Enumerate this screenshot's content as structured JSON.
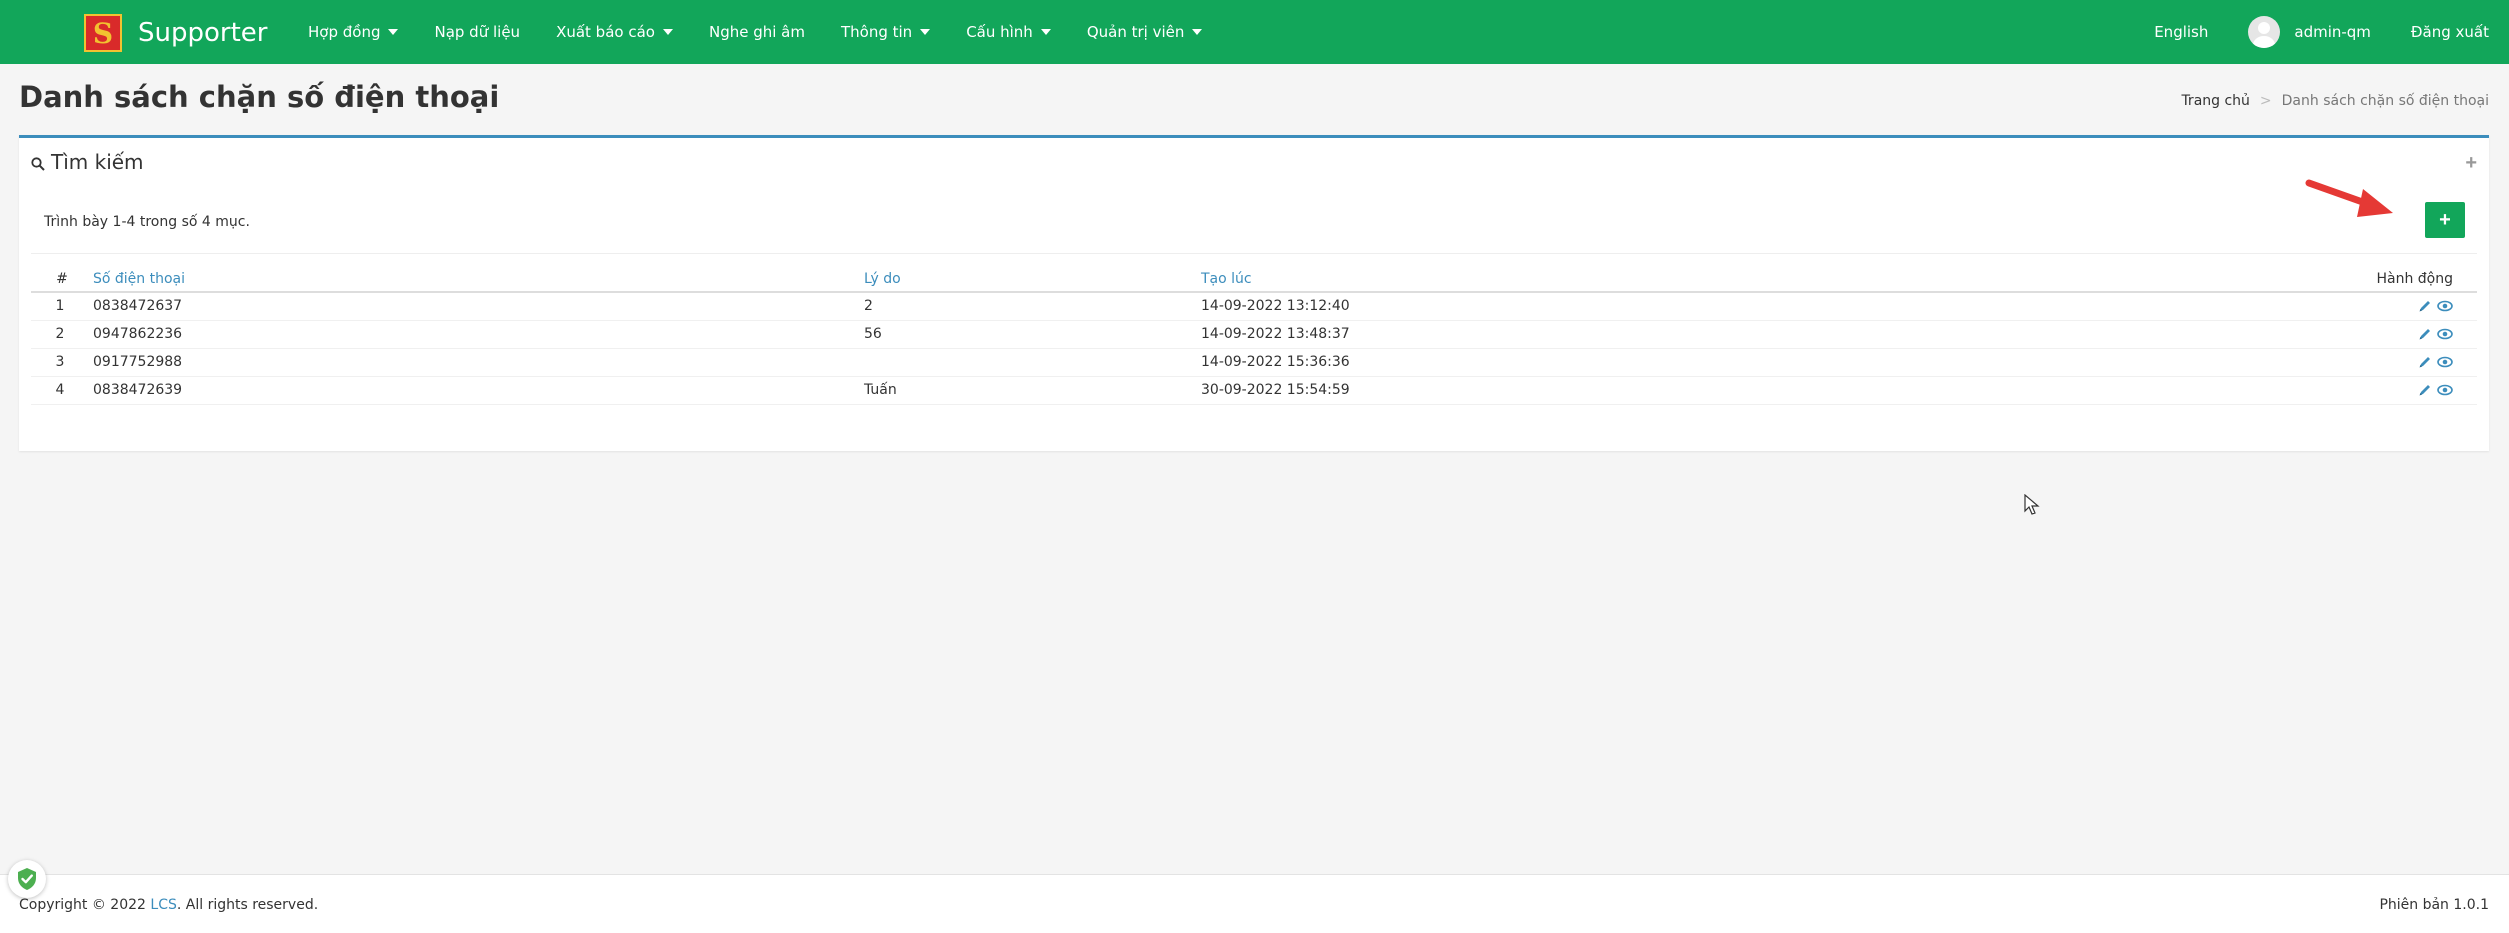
{
  "brand": {
    "logo_letter": "S",
    "name": "Supporter"
  },
  "nav": {
    "items": [
      {
        "label": "Hợp đồng",
        "dropdown": true
      },
      {
        "label": "Nạp dữ liệu",
        "dropdown": false
      },
      {
        "label": "Xuất báo cáo",
        "dropdown": true
      },
      {
        "label": "Nghe ghi âm",
        "dropdown": false
      },
      {
        "label": "Thông tin",
        "dropdown": true
      },
      {
        "label": "Cấu hình",
        "dropdown": true
      },
      {
        "label": "Quản trị viên",
        "dropdown": true
      }
    ],
    "language": "English",
    "user": "admin-qm",
    "logout": "Đăng xuất"
  },
  "page": {
    "title": "Danh sách chặn số điện thoại"
  },
  "breadcrumb": {
    "home": "Trang chủ",
    "separator": ">",
    "current": "Danh sách chặn số điện thoại"
  },
  "panel": {
    "heading": "Tìm kiếm",
    "summary": "Trình bày 1-4 trong số 4 mục.",
    "add_button": "+"
  },
  "table": {
    "headers": {
      "num": "#",
      "phone": "Số điện thoại",
      "reason": "Lý do",
      "created": "Tạo lúc",
      "action": "Hành động"
    },
    "rows": [
      {
        "num": "1",
        "phone": "0838472637",
        "reason": "2",
        "created": "14-09-2022 13:12:40"
      },
      {
        "num": "2",
        "phone": "0947862236",
        "reason": "56",
        "created": "14-09-2022 13:48:37"
      },
      {
        "num": "3",
        "phone": "0917752988",
        "reason": "",
        "created": "14-09-2022 15:36:36"
      },
      {
        "num": "4",
        "phone": "0838472639",
        "reason": "Tuấn",
        "created": "30-09-2022 15:54:59"
      }
    ]
  },
  "footer": {
    "copyright_prefix": "Copyright © 2022 ",
    "copyright_link": "LCS",
    "copyright_suffix": ". All rights reserved.",
    "version": "Phiên bản 1.0.1"
  },
  "colors": {
    "primary": "#12a65a",
    "link": "#3c8dbc",
    "accent_arrow": "#e53935"
  }
}
